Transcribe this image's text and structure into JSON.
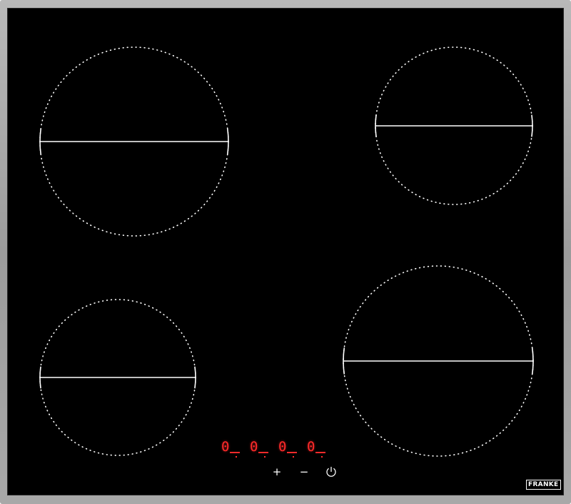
{
  "appliance": {
    "type": "ceramic hob",
    "frame_color": "#a7a7a7",
    "glass_color": "#000000",
    "marking_color": "#ffffff"
  },
  "cooking_zones": [
    {
      "id": "front-left-large",
      "name": "large zone top-left"
    },
    {
      "id": "back-right",
      "name": "zone top-right"
    },
    {
      "id": "front-left-small",
      "name": "zone bottom-left"
    },
    {
      "id": "front-right-large",
      "name": "large zone bottom-right"
    }
  ],
  "display": {
    "color": "#ff2a2a",
    "digits": [
      "0",
      "0",
      "0",
      "0"
    ]
  },
  "controls": {
    "plus_label": "+",
    "minus_label": "−",
    "power_icon": "power-icon"
  },
  "brand": {
    "logo_text": "FRANKE"
  }
}
